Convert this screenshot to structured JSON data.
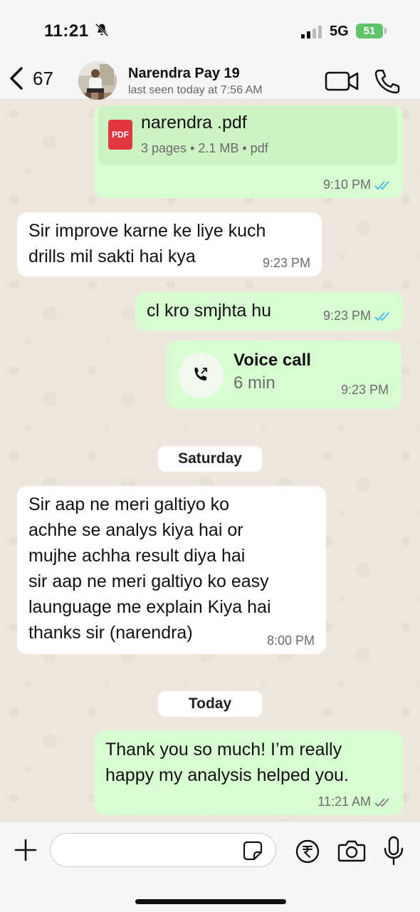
{
  "status_bar": {
    "time": "11:21",
    "network": "5G",
    "battery": "51"
  },
  "header": {
    "back_count": "67",
    "contact_name": "Narendra Pay 19",
    "last_seen": "last seen today at 7:56 AM"
  },
  "messages": [
    {
      "type": "document",
      "direction": "outgoing",
      "file_name": "narendra .pdf",
      "file_info": "3 pages • 2.1 MB • pdf",
      "file_icon_label": "PDF",
      "time": "9:10 PM",
      "status": "read"
    },
    {
      "type": "text",
      "direction": "incoming",
      "text": "Sir improve karne ke liye kuch\ndrills mil sakti hai kya",
      "time": "9:23 PM"
    },
    {
      "type": "text",
      "direction": "outgoing",
      "text": "cl kro smjhta hu",
      "time": "9:23 PM",
      "status": "read"
    },
    {
      "type": "call",
      "direction": "outgoing",
      "title": "Voice call",
      "duration": "6 min",
      "time": "9:23 PM"
    },
    {
      "type": "date",
      "label": "Saturday"
    },
    {
      "type": "text",
      "direction": "incoming",
      "text": "Sir aap ne meri galtiyo ko\nachhe se analys kiya hai or\nmujhe achha result diya hai\nsir aap ne meri galtiyo ko easy\nlaunguage me explain Kiya hai\nthanks sir (narendra)",
      "time": "8:00 PM"
    },
    {
      "type": "date",
      "label": "Today"
    },
    {
      "type": "text",
      "direction": "outgoing",
      "text": "Thank you so much! I’m really\nhappy my analysis helped you.",
      "time": "11:21 AM",
      "status": "delivered"
    }
  ],
  "composer": {
    "value": "",
    "placeholder": ""
  },
  "colors": {
    "outgoing_bubble": "#d9fdd3",
    "incoming_bubble": "#ffffff",
    "read_ticks": "#53bdeb",
    "delivered_ticks": "#8a8a8a",
    "battery": "#5fc46a"
  }
}
